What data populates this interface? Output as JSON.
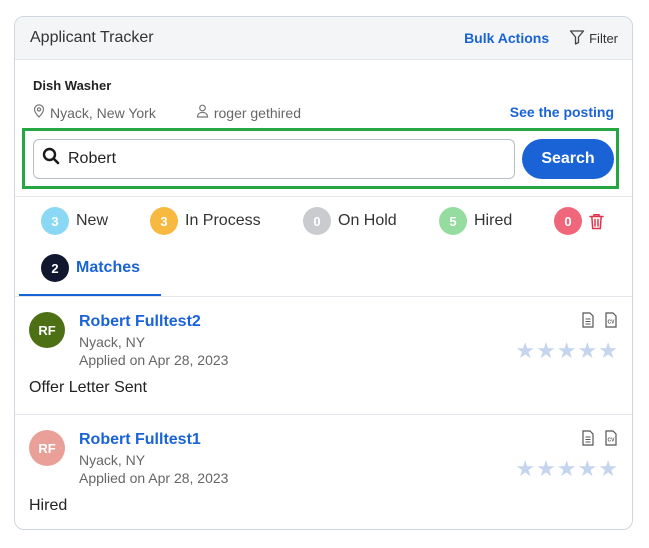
{
  "header": {
    "title": "Applicant Tracker",
    "bulk_actions": "Bulk Actions",
    "filter": "Filter"
  },
  "job": {
    "title": "Dish Washer",
    "location": "Nyack, New York",
    "recruiter": "roger gethired",
    "see_posting": "See the posting"
  },
  "search": {
    "value": "Robert",
    "button": "Search"
  },
  "tabs": [
    {
      "count": "3",
      "label": "New",
      "color": "#8bd8f5"
    },
    {
      "count": "3",
      "label": "In Process",
      "color": "#f7b940"
    },
    {
      "count": "0",
      "label": "On Hold",
      "color": "#c9cbce"
    },
    {
      "count": "5",
      "label": "Hired",
      "color": "#95dca0"
    },
    {
      "count": "0",
      "label": "",
      "color": "#f0677c"
    },
    {
      "count": "2",
      "label": "Matches",
      "color": "#11172e"
    }
  ],
  "applicants": [
    {
      "initials": "RF",
      "name": "Robert Fulltest2",
      "location": "Nyack, NY",
      "applied": "Applied on Apr 28, 2023",
      "status": "Offer Letter Sent",
      "avatar_color": "#4d7015",
      "rating": 0
    },
    {
      "initials": "RF",
      "name": "Robert Fulltest1",
      "location": "Nyack, NY",
      "applied": "Applied on Apr 28, 2023",
      "status": "Hired",
      "avatar_color": "#e9a098",
      "rating": 0
    }
  ],
  "colors": {
    "accent": "#1a63d6",
    "highlight": "#27a744",
    "delete": "#e0334b"
  },
  "icons": [
    "filter-icon",
    "location-pin-icon",
    "user-icon",
    "search-icon",
    "trash-icon",
    "document-icon",
    "cv-icon",
    "star-icon"
  ]
}
